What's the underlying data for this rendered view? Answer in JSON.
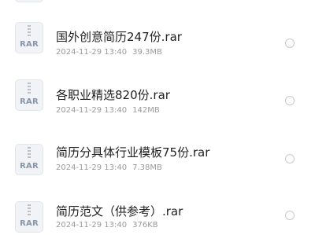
{
  "files": [
    {
      "icon": "rar-archive-icon",
      "icon_label": "RAR",
      "name": "国外创意简历247份.rar",
      "date": "2024-11-29 13:40",
      "size": "39.3MB"
    },
    {
      "icon": "rar-archive-icon",
      "icon_label": "RAR",
      "name": "各职业精选820份.rar",
      "date": "2024-11-29 13:40",
      "size": "142MB"
    },
    {
      "icon": "rar-archive-icon",
      "icon_label": "RAR",
      "name": "简历分具体行业模板75份.rar",
      "date": "2024-11-29 13:40",
      "size": "7.38MB"
    },
    {
      "icon": "rar-archive-icon",
      "icon_label": "RAR",
      "name": "简历范文（供参考）.rar",
      "date": "2024-11-29 13:40",
      "size": "376KB"
    }
  ],
  "colors": {
    "name_text": "#1f1f1f",
    "meta_text": "#9a9a9a",
    "icon_label": "#8a96a8",
    "radio_border": "#c9c9c9"
  }
}
